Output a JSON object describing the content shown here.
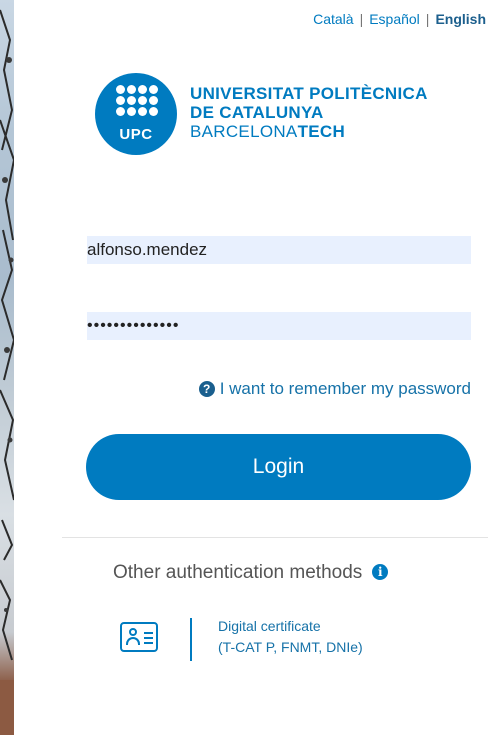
{
  "languages": {
    "catalan": "Català",
    "spanish": "Español",
    "english": "English",
    "separator": "|"
  },
  "logo": {
    "abbr": "UPC",
    "line1": "UNIVERSITAT POLITÈCNICA",
    "line2": "DE CATALUNYA",
    "line3_regular": "BARCELONA",
    "line3_bold": "TECH",
    "color": "#007bc0"
  },
  "form": {
    "username_value": "alfonso.mendez",
    "password_value": "••••••••••••••",
    "remember_label": "I want to remember my password",
    "login_label": "Login"
  },
  "other_auth": {
    "title": "Other authentication methods",
    "info_icon": "i",
    "help_icon": "?",
    "certificate_title": "Digital certificate",
    "certificate_subtitle": "(T-CAT P, FNMT, DNIe)"
  },
  "colors": {
    "accent": "#007bc0",
    "field_bg": "#e8f0fe"
  }
}
